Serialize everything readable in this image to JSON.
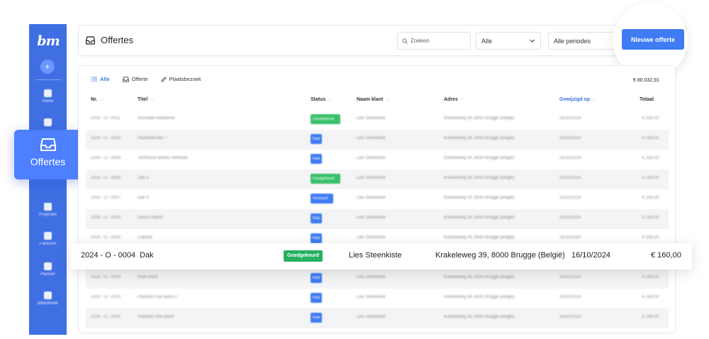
{
  "sidebar": {
    "logo_text": "bm",
    "add_symbol": "+",
    "nav": [
      {
        "label": "Home",
        "icon": "home-icon"
      },
      {
        "label": "",
        "icon": "team-icon"
      },
      {
        "label": "Projecten",
        "icon": "projects-icon"
      },
      {
        "label": "Facturen",
        "icon": "invoice-icon"
      },
      {
        "label": "Planner",
        "icon": "calendar-icon"
      },
      {
        "label": "Bibliotheek",
        "icon": "library-icon"
      }
    ],
    "active_label": "Offertes",
    "active_icon": "inbox-tray-icon",
    "color": "#3f6fe3"
  },
  "header": {
    "title": "Offertes",
    "search_placeholder": "Zoeken",
    "status_select": "Alle",
    "period_select": "Alle periodes",
    "new_button": "Nieuwe offerte"
  },
  "tabs": [
    {
      "label": "Alle",
      "icon": "list-icon",
      "active": true
    },
    {
      "label": "Offerte",
      "icon": "inbox-tray-icon",
      "active": false
    },
    {
      "label": "Plaatsbezoek",
      "icon": "pencil-icon",
      "active": false
    }
  ],
  "total_sum": "€ 80.032,91",
  "columns": [
    "Nr.",
    "Titel",
    "Status",
    "Naam klant",
    "Adres",
    "Gewijzigd op",
    "Totaal"
  ],
  "rows": [
    {
      "nr": "2024 - O - 0011",
      "titel": "renovatie badkamer",
      "status": "Goedgekeurd",
      "status_color": "green",
      "klant": "Lies Steenkiste",
      "adres": "Krakeleweg 39, 8000 Brugge (België)",
      "datum": "16/10/2024",
      "totaal": "€ 160,00"
    },
    {
      "nr": "2024 - O - 0010",
      "titel": "Plaatsbezoek 7",
      "status": "Klad",
      "status_color": "blue",
      "klant": "Lies Steenkiste",
      "adres": "Krakeleweg 39, 8000 Brugge (België)",
      "datum": "16/10/2024",
      "totaal": "€ 160,00"
    },
    {
      "nr": "2024 - O - 0009",
      "titel": "Technisch advies methode",
      "status": "Klad",
      "status_color": "blue",
      "klant": "Lies Steenkiste",
      "adres": "Krakeleweg 39, 8000 Brugge (België)",
      "datum": "16/10/2024",
      "totaal": "€ 160,00"
    },
    {
      "nr": "2024 - O - 0008",
      "titel": "Dak 2",
      "status": "Goedgekeurd",
      "status_color": "green",
      "klant": "Lies Steenkiste",
      "adres": "Krakeleweg 39, 8000 Brugge (België)",
      "datum": "16/10/2024",
      "totaal": "€ 160,00"
    },
    {
      "nr": "2024 - O - 0007",
      "titel": "Dak 3",
      "status": "Verstuurd",
      "status_color": "blue-wide",
      "klant": "Lies Steenkiste",
      "adres": "Krakeleweg 39, 8000 Brugge (België)",
      "datum": "16/10/2024",
      "totaal": "€ 160,00"
    },
    {
      "nr": "2024 - O - 0006",
      "titel": "Deuco import",
      "status": "Klad",
      "status_color": "blue",
      "klant": "Lies Steenkiste",
      "adres": "Krakeleweg 39, 8000 Brugge (België)",
      "datum": "16/10/2024",
      "totaal": "€ 160,00"
    },
    {
      "nr": "2024 - O - 0005",
      "titel": "Cabasa",
      "status": "Klad",
      "status_color": "blue",
      "klant": "Lies Steenkiste",
      "adres": "Krakeleweg 39, 8000 Brugge (België)",
      "datum": "16/10/2024",
      "totaal": "€ 160,00"
    },
    {
      "nr": "2024 - O - 0003",
      "titel": "HSB wand",
      "status": "Klad",
      "status_color": "blue",
      "klant": "Lies Steenkiste",
      "adres": "Krakeleweg 39, 8000 Brugge (België)",
      "datum": "16/10/2024",
      "totaal": "€ 160,00"
    },
    {
      "nr": "2024 - O - 0002",
      "titel": "Plaatsen hsb wand 2",
      "status": "Klad",
      "status_color": "blue",
      "klant": "Lies Steenkiste",
      "adres": "Krakeleweg 39, 8000 Brugge (België)",
      "datum": "16/10/2024",
      "totaal": "€ 160,00"
    },
    {
      "nr": "2024 - O - 0001",
      "titel": "Plaatsen hsb wand",
      "status": "Klad",
      "status_color": "blue",
      "klant": "Lies Steenkiste",
      "adres": "Krakeleweg 39, 8000 Brugge (België)",
      "datum": "16/10/2024",
      "totaal": "€ 160,00"
    }
  ],
  "highlight_row": {
    "nr": "2024 - O - 0004",
    "titel": "Dak",
    "status": "Goedgekeurd",
    "klant": "Lies Steenkiste",
    "adres": "Krakeleweg 39, 8000 Brugge (België)",
    "datum": "16/10/2024",
    "totaal": "€ 160,00"
  },
  "colors": {
    "primary": "#3f7bf3",
    "approved": "#25b160",
    "draft": "#3f7bf3"
  }
}
